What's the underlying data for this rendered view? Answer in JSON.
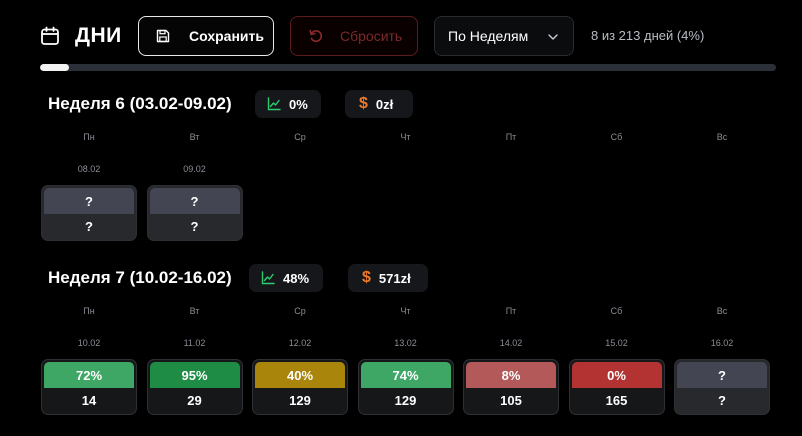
{
  "header": {
    "title": "ДНИ",
    "save_label": "Сохранить",
    "reset_label": "Сбросить",
    "view_select": "По Неделям",
    "days_count": "8 из 213 дней (4%)",
    "progress": 0.04
  },
  "colors": {
    "accent_green": "#2ecc71",
    "accent_orange": "#f07a2a",
    "danger": "#7a2a2a"
  },
  "icons": {
    "title": "calendar-icon",
    "save": "floppy-disk-icon",
    "reset": "undo-icon",
    "select": "chevron-down-icon",
    "percent_pill": "trend-chart-icon",
    "money_pill": "dollar-icon"
  },
  "weeks": [
    {
      "title": "Неделя 6 (03.02-09.02)",
      "percent": "0%",
      "money": "0zł",
      "day_names": [
        "Пн",
        "Вт",
        "Ср",
        "Чт",
        "Пт",
        "Сб",
        "Вс"
      ],
      "days": [
        {
          "date": "08.02",
          "top": "?",
          "bottom": "?",
          "color": "#434652",
          "unknown": true
        },
        {
          "date": "09.02",
          "top": "?",
          "bottom": "?",
          "color": "#434652",
          "unknown": true
        }
      ]
    },
    {
      "title": "Неделя 7 (10.02-16.02)",
      "percent": "48%",
      "money": "571zł",
      "day_names": [
        "Пн",
        "Вт",
        "Ср",
        "Чт",
        "Пт",
        "Сб",
        "Вс"
      ],
      "days": [
        {
          "date": "10.02",
          "top": "72%",
          "bottom": "14",
          "color": "#3ea765"
        },
        {
          "date": "11.02",
          "top": "95%",
          "bottom": "29",
          "color": "#1e8c45"
        },
        {
          "date": "12.02",
          "top": "40%",
          "bottom": "129",
          "color": "#a9850c"
        },
        {
          "date": "13.02",
          "top": "74%",
          "bottom": "129",
          "color": "#3ea765"
        },
        {
          "date": "14.02",
          "top": "8%",
          "bottom": "105",
          "color": "#b35959"
        },
        {
          "date": "15.02",
          "top": "0%",
          "bottom": "165",
          "color": "#b33232"
        },
        {
          "date": "16.02",
          "top": "?",
          "bottom": "?",
          "color": "#434652",
          "unknown": true
        }
      ]
    }
  ]
}
